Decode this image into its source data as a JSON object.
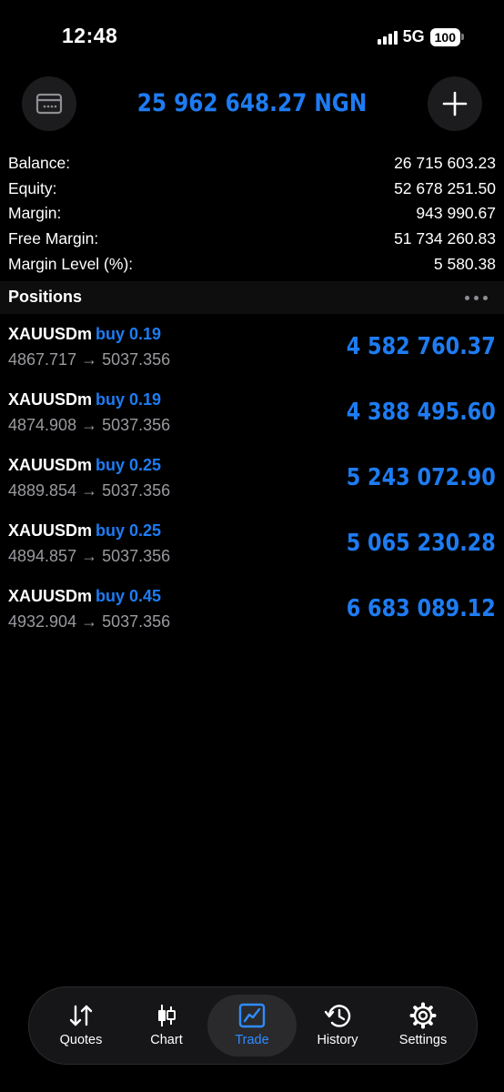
{
  "status_bar": {
    "time": "12:48",
    "network": "5G",
    "battery": "100"
  },
  "header": {
    "account_total": "25 962 648.27 NGN"
  },
  "summary": [
    {
      "label": "Balance:",
      "value": "26 715 603.23"
    },
    {
      "label": "Equity:",
      "value": "52 678 251.50"
    },
    {
      "label": "Margin:",
      "value": "943 990.67"
    },
    {
      "label": "Free Margin:",
      "value": "51 734 260.83"
    },
    {
      "label": "Margin Level (%):",
      "value": "5 580.38"
    }
  ],
  "positions": {
    "title": "Positions",
    "items": [
      {
        "symbol": "XAUUSDm",
        "side": "buy 0.19",
        "prices": "4867.717 → 5037.356",
        "profit": "4 582 760.37"
      },
      {
        "symbol": "XAUUSDm",
        "side": "buy 0.19",
        "prices": "4874.908 → 5037.356",
        "profit": "4 388 495.60"
      },
      {
        "symbol": "XAUUSDm",
        "side": "buy 0.25",
        "prices": "4889.854 → 5037.356",
        "profit": "5 243 072.90"
      },
      {
        "symbol": "XAUUSDm",
        "side": "buy 0.25",
        "prices": "4894.857 → 5037.356",
        "profit": "5 065 230.28"
      },
      {
        "symbol": "XAUUSDm",
        "side": "buy 0.45",
        "prices": "4932.904 → 5037.356",
        "profit": "6 683 089.12"
      }
    ]
  },
  "tabbar": {
    "items": [
      {
        "label": "Quotes",
        "icon": "sort-arrows-icon"
      },
      {
        "label": "Chart",
        "icon": "candlestick-icon"
      },
      {
        "label": "Trade",
        "icon": "trend-chart-icon",
        "active": true
      },
      {
        "label": "History",
        "icon": "history-clock-icon"
      },
      {
        "label": "Settings",
        "icon": "gear-icon"
      }
    ]
  },
  "colors": {
    "accent": "#1e7cf2",
    "background": "#000000",
    "muted_text": "#9a9a9f"
  }
}
